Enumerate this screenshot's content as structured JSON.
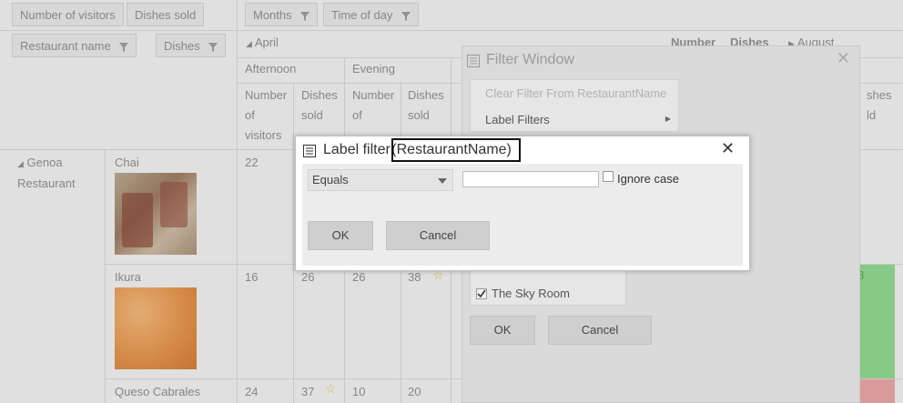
{
  "pivot": {
    "header_fields": {
      "values": [
        "Number of visitors",
        "Dishes sold"
      ],
      "columns": [
        "Months",
        "Time of day"
      ],
      "rows": [
        "Restaurant name",
        "Dishes"
      ]
    },
    "month_expanded": "April",
    "month_collapsed": "August",
    "summary_headers": [
      "Number",
      "Dishes"
    ],
    "time_groups": [
      "Afternoon",
      "Evening"
    ],
    "measure_headers": {
      "visitors": [
        "Number",
        "of",
        "visitors"
      ],
      "dishes": [
        "Dishes",
        "sold"
      ],
      "visitors_short": [
        "Number",
        "of"
      ]
    },
    "right_partial_header": [
      "shes",
      "ld"
    ],
    "restaurant": [
      "Genoa",
      "Restaurant"
    ],
    "dishes": [
      "Chai",
      "Ikura",
      "Queso Cabrales"
    ],
    "rows": [
      {
        "values": [
          "22"
        ]
      },
      {
        "values": [
          "16",
          "26",
          "26",
          "38"
        ]
      },
      {
        "values": [
          "24",
          "37",
          "10",
          "20"
        ]
      }
    ],
    "partial_right_value": "8"
  },
  "filter_window": {
    "title": "Filter Window",
    "menu_clear": "Clear Filter From RestaurantName",
    "menu_label_filters": "Label Filters",
    "list_item": "The Sky Room",
    "ok_label": "OK",
    "cancel_label": "Cancel"
  },
  "label_filter": {
    "title_prefix": "Label filter",
    "title_field": "(RestaurantName)",
    "condition": "Equals",
    "value": "",
    "ignore_case_label": "Ignore case",
    "ok_label": "OK",
    "cancel_label": "Cancel"
  },
  "colors": {
    "green_cell": "#8fd48f",
    "red_cell": "#e7a3a3",
    "star": "#e3c24a"
  }
}
